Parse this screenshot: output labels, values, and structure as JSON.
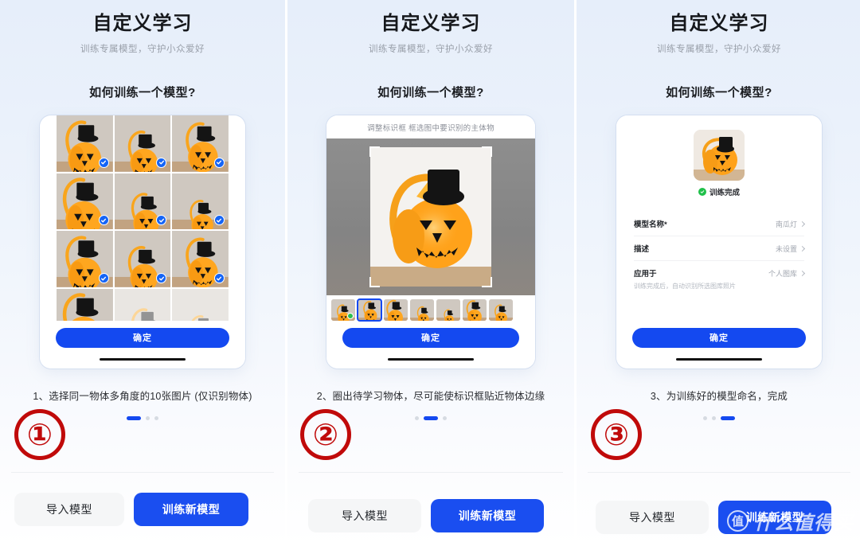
{
  "app": {
    "title": "自定义学习",
    "subtitle": "训练专属模型，守护小众爱好",
    "section_question": "如何训练一个模型?"
  },
  "colors": {
    "primary_blue": "#1449f0",
    "badge_red": "#c00a0a",
    "success_green": "#20c04a",
    "panel_bg_top": "#e6eefa",
    "panel_bg_bottom": "#ffffff"
  },
  "footer": {
    "import_label": "导入模型",
    "train_label": "训练新模型"
  },
  "watermark": {
    "mark": "值",
    "text": "什么值得买"
  },
  "panels": [
    {
      "step_number": "①",
      "caption": "1、选择同一物体多角度的10张图片 (仅识别物体)",
      "active_dot_index": 0,
      "confirm_label": "确定",
      "grid": {
        "selected_count": 10,
        "total_count": 12,
        "cells": [
          {
            "selected": true,
            "view": "pumpkin-front-crop"
          },
          {
            "selected": true,
            "view": "pumpkin-front-crop-2"
          },
          {
            "selected": true,
            "view": "pumpkin-face-crop"
          },
          {
            "selected": true,
            "view": "pumpkin-angle-left"
          },
          {
            "selected": true,
            "view": "pumpkin-front-hat"
          },
          {
            "selected": true,
            "view": "pumpkin-side-thin"
          },
          {
            "selected": true,
            "view": "pumpkin-front-large"
          },
          {
            "selected": true,
            "view": "pumpkin-tilt-right"
          },
          {
            "selected": true,
            "view": "pumpkin-side-face"
          },
          {
            "selected": true,
            "view": "pumpkin-edge-thin"
          },
          {
            "selected": false,
            "view": "pumpkin-dim-1"
          },
          {
            "selected": false,
            "view": "pumpkin-dim-2"
          }
        ]
      }
    },
    {
      "step_number": "②",
      "caption": "2、圈出待学习物体，尽可能使标识框贴近物体边缘",
      "active_dot_index": 1,
      "confirm_label": "确定",
      "editor": {
        "hint": "调整标识框 框选图中要识别的主体物",
        "selected_thumb_index": 1,
        "thumbs": [
          {
            "checked": true,
            "selected": false
          },
          {
            "checked": false,
            "selected": true
          },
          {
            "checked": false,
            "selected": false
          },
          {
            "checked": false,
            "selected": false
          },
          {
            "checked": false,
            "selected": false
          },
          {
            "checked": false,
            "selected": false
          },
          {
            "checked": false,
            "selected": false
          }
        ]
      }
    },
    {
      "step_number": "③",
      "caption": "3、为训练好的模型命名，完成",
      "active_dot_index": 2,
      "confirm_label": "确定",
      "result": {
        "status_text": "训练完成",
        "fields": [
          {
            "label": "模型名称*",
            "value": "南瓜灯",
            "note": ""
          },
          {
            "label": "描述",
            "value": "未设置",
            "note": ""
          },
          {
            "label": "应用于",
            "value": "个人图库",
            "note": "训练完成后，自动识别所选图库照片"
          }
        ]
      }
    }
  ]
}
